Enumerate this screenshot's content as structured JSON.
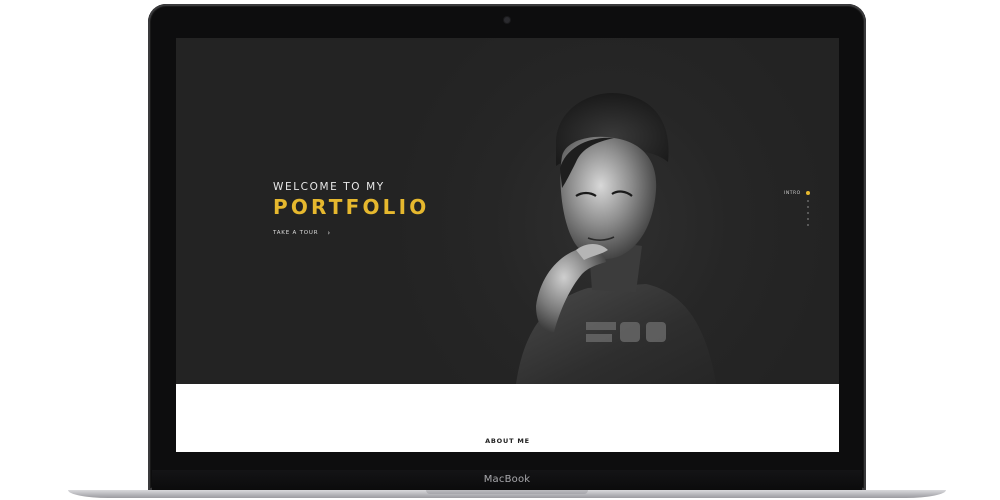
{
  "device": {
    "brand_label": "MacBook"
  },
  "hero": {
    "welcome_text": "WELCOME TO MY",
    "title_text": "PORTFOLIO",
    "cta_label": "TAKE A TOUR",
    "cta_arrow": "›",
    "accent_color": "#e6b82e",
    "background_color": "#262626"
  },
  "dot_nav": {
    "active_label": "INTRO"
  },
  "about": {
    "title": "ABOUT ME"
  }
}
